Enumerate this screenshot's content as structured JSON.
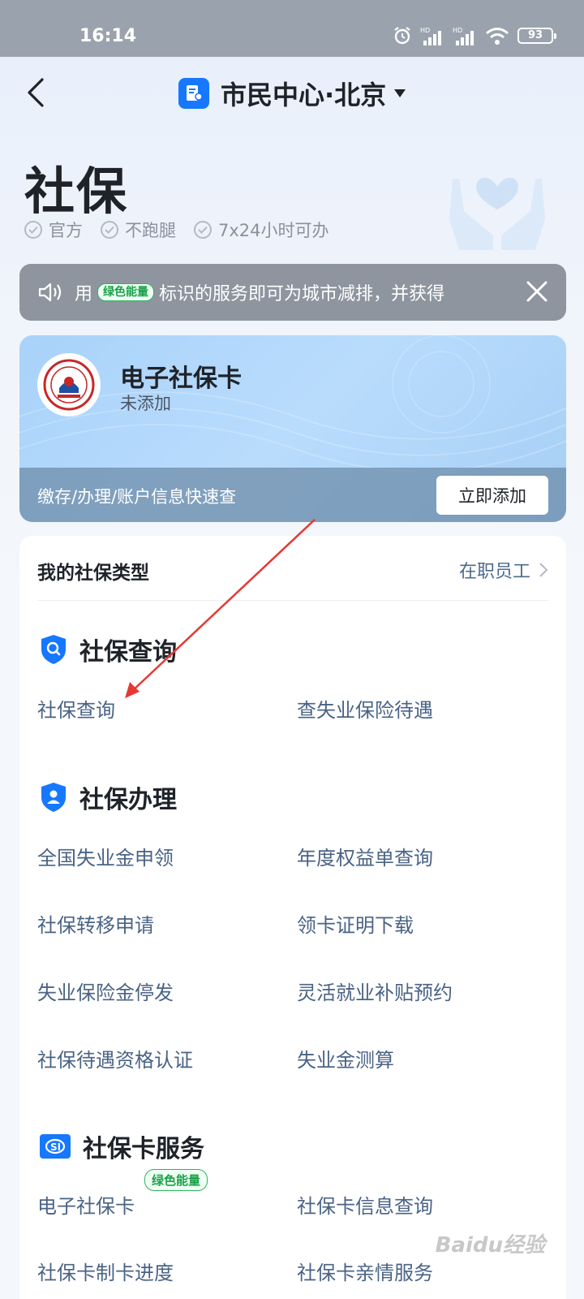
{
  "status_bar": {
    "time": "16:14",
    "battery": "93"
  },
  "nav": {
    "title": "市民中心·北京"
  },
  "page": {
    "title": "社保",
    "tags": [
      "官方",
      "不跑腿",
      "7x24小时可办"
    ]
  },
  "notice": {
    "prefix": "用",
    "badge": "绿色能量",
    "text": "标识的服务即可为城市减排，并获得"
  },
  "ss_card": {
    "title": "电子社保卡",
    "status": "未添加",
    "desc": "缴存/办理/账户信息快速查",
    "add_button": "立即添加"
  },
  "my_type": {
    "label": "我的社保类型",
    "value": "在职员工"
  },
  "sections": {
    "query": {
      "title": "社保查询",
      "items": [
        "社保查询",
        "查失业保险待遇"
      ]
    },
    "handle": {
      "title": "社保办理",
      "items": [
        "全国失业金申领",
        "年度权益单查询",
        "社保转移申请",
        "领卡证明下载",
        "失业保险金停发",
        "灵活就业补贴预约",
        "社保待遇资格认证",
        "失业金测算"
      ]
    },
    "card": {
      "title": "社保卡服务",
      "badge": "绿色能量",
      "items": [
        "电子社保卡",
        "社保卡信息查询",
        "社保卡制卡进度",
        "社保卡亲情服务"
      ]
    }
  },
  "watermark": "Baidu经验",
  "colors": {
    "accent": "#1677ff",
    "link": "#4a6385",
    "green": "#2db55d",
    "arrow": "#e53935"
  }
}
